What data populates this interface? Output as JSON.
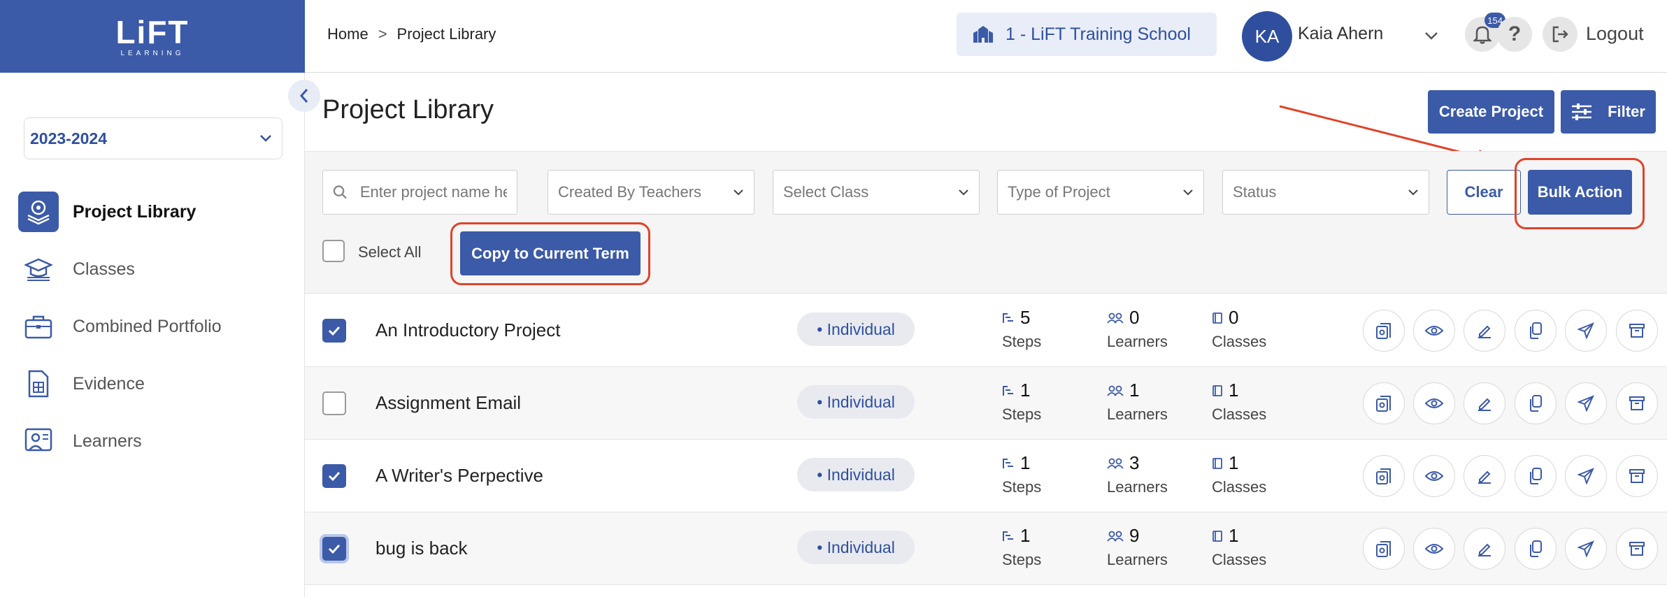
{
  "app": {
    "logo_main": "LiFT",
    "logo_sub": "LEARNING"
  },
  "sidebar": {
    "year": "2023-2024",
    "items": [
      {
        "label": "Project Library",
        "active": true
      },
      {
        "label": "Classes"
      },
      {
        "label": "Combined Portfolio"
      },
      {
        "label": "Evidence"
      },
      {
        "label": "Learners"
      }
    ]
  },
  "header": {
    "breadcrumb": {
      "home": "Home",
      "separator": ">",
      "current": "Project Library"
    },
    "school": "1 - LiFT Training School",
    "user": {
      "initials": "KA",
      "name": "Kaia Ahern"
    },
    "notifications": "154",
    "help": "?",
    "logout": "Logout"
  },
  "page": {
    "title": "Project Library",
    "create_button": "Create Project",
    "filter_button": "Filter"
  },
  "filters": {
    "search_placeholder": "Enter project name here",
    "created_by": "Created By Teachers",
    "class": "Select Class",
    "type": "Type of Project",
    "status": "Status",
    "clear": "Clear",
    "bulk_action": "Bulk Action",
    "select_all": "Select All",
    "copy_button": "Copy to Current Term"
  },
  "stat_labels": {
    "steps": "Steps",
    "learners": "Learners",
    "classes": "Classes"
  },
  "projects": [
    {
      "name": "An Introductory Project",
      "type": "• Individual",
      "steps": "5",
      "learners": "0",
      "classes": "0",
      "checked": true
    },
    {
      "name": "Assignment Email",
      "type": "• Individual",
      "steps": "1",
      "learners": "1",
      "classes": "1",
      "checked": false
    },
    {
      "name": "A Writer's Perpective",
      "type": "• Individual",
      "steps": "1",
      "learners": "3",
      "classes": "1",
      "checked": true
    },
    {
      "name": "bug is back",
      "type": "• Individual",
      "steps": "1",
      "learners": "9",
      "classes": "1",
      "checked": true
    }
  ],
  "colors": {
    "brand": "#3b5aa8",
    "annotation": "#e0432b"
  }
}
